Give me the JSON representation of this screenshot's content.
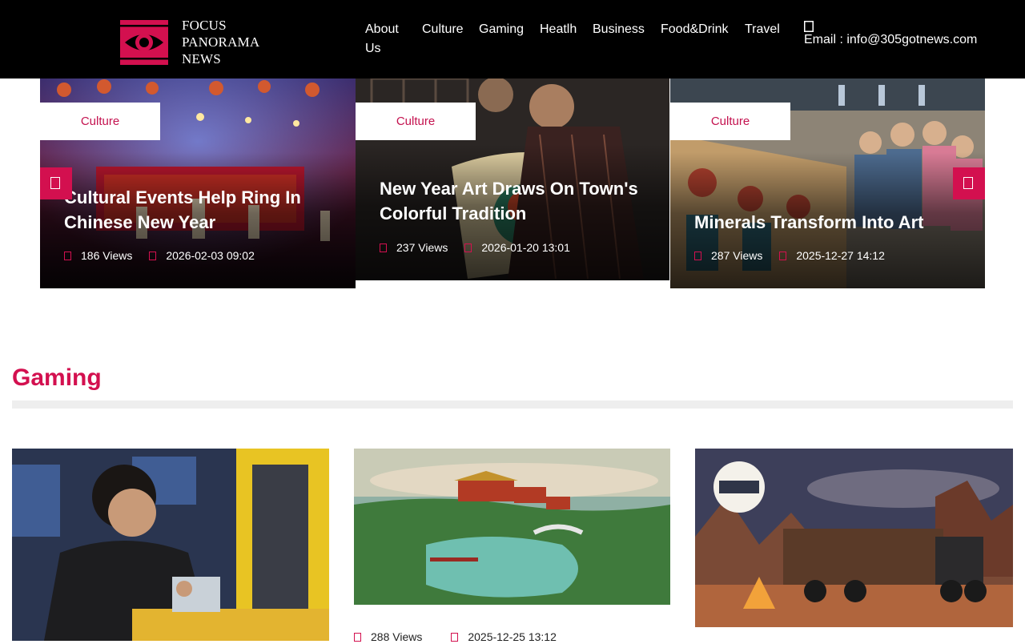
{
  "header": {
    "logo_lines": [
      "FOCUS",
      "PANORAMA",
      "NEWS"
    ],
    "nav": [
      "About Us",
      "Culture",
      "Gaming",
      "Heatlh",
      "Business",
      "Food&Drink",
      "Travel"
    ],
    "contact_icon": "envelope-icon",
    "email_text": "Email : info@305gotnews.com"
  },
  "colors": {
    "accent": "#d3104f",
    "header_bg": "#000000",
    "tag_text": "#c4124f"
  },
  "slider": {
    "cards": [
      {
        "category": "Culture",
        "title": "Cultural Events Help Ring In Chinese New Year",
        "views": "186 Views",
        "date": "2026-02-03 09:02",
        "image": "stage-performance-image"
      },
      {
        "category": "Culture",
        "title": "New Year Art Draws On Town's Colorful Tradition",
        "views": "237 Views",
        "date": "2026-01-20 13:01",
        "image": "painter-artwork-image"
      },
      {
        "category": "Culture",
        "title": "Minerals Transform Into Art",
        "views": "287 Views",
        "date": "2025-12-27 14:12",
        "image": "mural-children-image"
      }
    ],
    "prev_icon": "chevron-left-icon",
    "next_icon": "chevron-right-icon"
  },
  "gaming": {
    "heading": "Gaming",
    "cards": [
      {
        "image": "gamer-with-phone-image"
      },
      {
        "image": "aerial-palace-garden-image",
        "views": "288 Views",
        "date": "2025-12-25 13:12"
      },
      {
        "image": "dustland-delivery-truck-image"
      }
    ]
  }
}
